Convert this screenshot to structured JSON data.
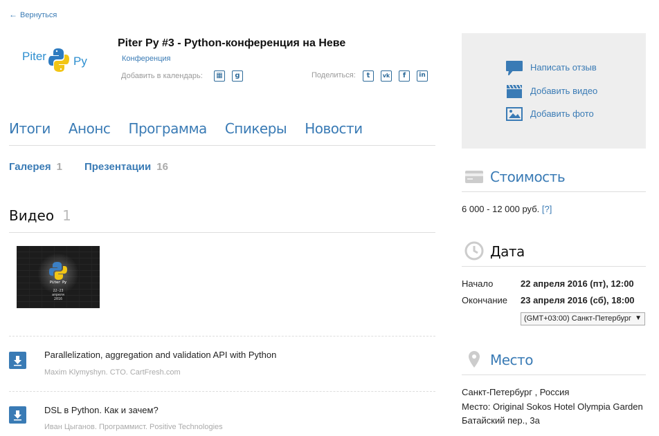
{
  "nav": {
    "back_label": "Вернуться"
  },
  "event": {
    "title": "Piter Py #3 - Python-конференция на Неве",
    "type": "Конференция",
    "calendar_label": "Добавить в календарь:",
    "share_label": "Поделиться:",
    "logo_text_left": "Piter",
    "logo_text_right": "Py"
  },
  "tabs": [
    "Итоги",
    "Анонс",
    "Программа",
    "Спикеры",
    "Новости"
  ],
  "subtabs": [
    {
      "label": "Галерея",
      "count": "1"
    },
    {
      "label": "Презентации",
      "count": "16"
    }
  ],
  "video": {
    "heading": "Видео",
    "count": "1",
    "thumb_text": [
      "Piter Py",
      "22-23",
      "апреля",
      "2016"
    ]
  },
  "presentations": [
    {
      "title": "Parallelization, aggregation and validation API with Python",
      "subtitle": "Maxim Klymyshyn. CTO. CartFresh.com"
    },
    {
      "title": "DSL в Python. Как и зачем?",
      "subtitle": "Иван Цыганов. Программист. Positive Technologies"
    }
  ],
  "sidebar": {
    "actions": [
      "Написать отзыв",
      "Добавить видео",
      "Добавить фото"
    ],
    "cost": {
      "heading": "Стоимость",
      "value": "6 000 - 12 000 руб.",
      "help": "[?]"
    },
    "date": {
      "heading": "Дата",
      "start_label": "Начало",
      "start_value": "22 апреля 2016 (пт), 12:00",
      "end_label": "Окончание",
      "end_value": "23 апреля 2016 (сб), 18:00",
      "timezone": "(GMT+03:00) Санкт-Петербург"
    },
    "place": {
      "heading": "Место",
      "city": "Санкт-Петербург , Россия",
      "venue": "Место: Original Sokos Hotel Olympia Garden",
      "address": "Батайский пер., 3а"
    }
  },
  "colors": {
    "accent": "#3a7bb5",
    "muted": "#aaaaaa",
    "sidebar_bg": "#eeeeee"
  }
}
